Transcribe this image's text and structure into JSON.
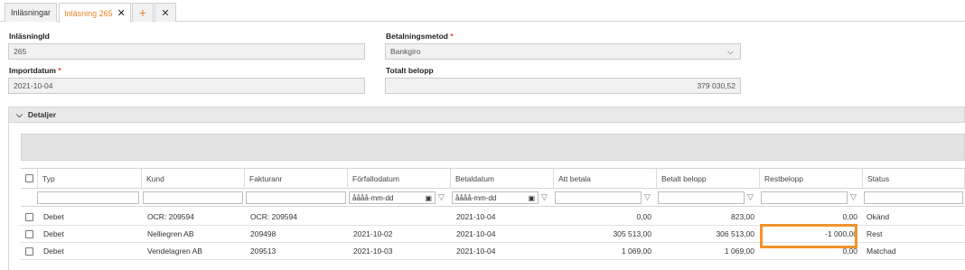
{
  "tabs": [
    {
      "label": "Inläsningar"
    },
    {
      "label": "Inläsning 265",
      "close": "✕"
    }
  ],
  "tab_actions": {
    "add": "+",
    "close": "✕"
  },
  "form": {
    "inlasningid": {
      "label": "InläsningId",
      "value": "265"
    },
    "betalningsmetod": {
      "label": "Betalningsmetod",
      "required": "*",
      "value": "Bankgiro"
    },
    "importdatum": {
      "label": "Importdatum",
      "required": "*",
      "value": "2021-10-04"
    },
    "totalt_belopp": {
      "label": "Totalt belopp",
      "value": "379 030,52"
    }
  },
  "details": {
    "title": "Detaljer"
  },
  "grid": {
    "columns": [
      "Typ",
      "Kund",
      "Fakturanr",
      "Förfallodatum",
      "Betaldatum",
      "Att betala",
      "Betalt belopp",
      "Restbelopp",
      "Status"
    ],
    "date_placeholder": "åååå-mm-dd",
    "rows": [
      {
        "typ": "Debet",
        "kund": "OCR: 209594",
        "fakturanr": "OCR: 209594",
        "forfallodatum": "",
        "betaldatum": "2021-10-04",
        "att_betala": "0,00",
        "betalt_belopp": "823,00",
        "restbelopp": "0,00",
        "status": "Okänd"
      },
      {
        "typ": "Debet",
        "kund": "Nelliegren AB",
        "fakturanr": "209498",
        "forfallodatum": "2021-10-02",
        "betaldatum": "2021-10-04",
        "att_betala": "305 513,00",
        "betalt_belopp": "306 513,00",
        "restbelopp": "-1 000,00",
        "status": "Rest"
      },
      {
        "typ": "Debet",
        "kund": "Vendelagren AB",
        "fakturanr": "209513",
        "forfallodatum": "2021-10-03",
        "betaldatum": "2021-10-04",
        "att_betala": "1 069,00",
        "betalt_belopp": "1 069,00",
        "restbelopp": "0,00",
        "status": "Matchad"
      }
    ]
  },
  "icons": {
    "chevron_down": "⌵",
    "calendar": "▣",
    "filter": "▽"
  },
  "colors": {
    "accent": "#e8832a",
    "highlight": "#f0932b",
    "required": "#e04a2a"
  }
}
